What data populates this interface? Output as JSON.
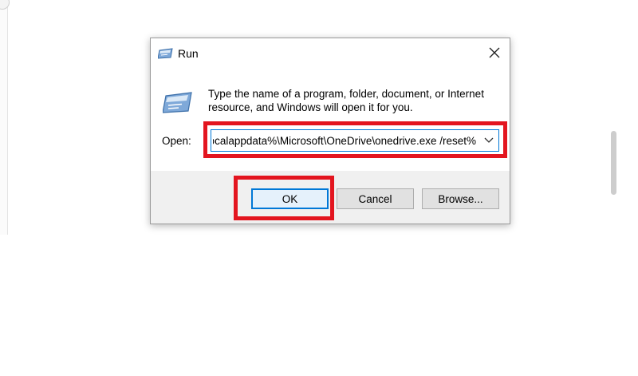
{
  "dialog": {
    "title": "Run",
    "description_line1": "Type the name of a program, folder, document, or Internet",
    "description_line2": "resource, and Windows will open it for you.",
    "open_label": "Open:",
    "open_value": "%localappdata%\\Microsoft\\OneDrive\\onedrive.exe /reset"
  },
  "buttons": {
    "ok_label": "OK",
    "cancel_label": "Cancel",
    "browse_label": "Browse..."
  },
  "icons": {
    "title": "run-icon",
    "description": "run-icon",
    "close": "close-icon",
    "dropdown": "chevron-down-icon"
  },
  "colors": {
    "highlight": "#e3151f",
    "focus_accent": "#0078d7",
    "button_bar": "#f0f0f0"
  }
}
